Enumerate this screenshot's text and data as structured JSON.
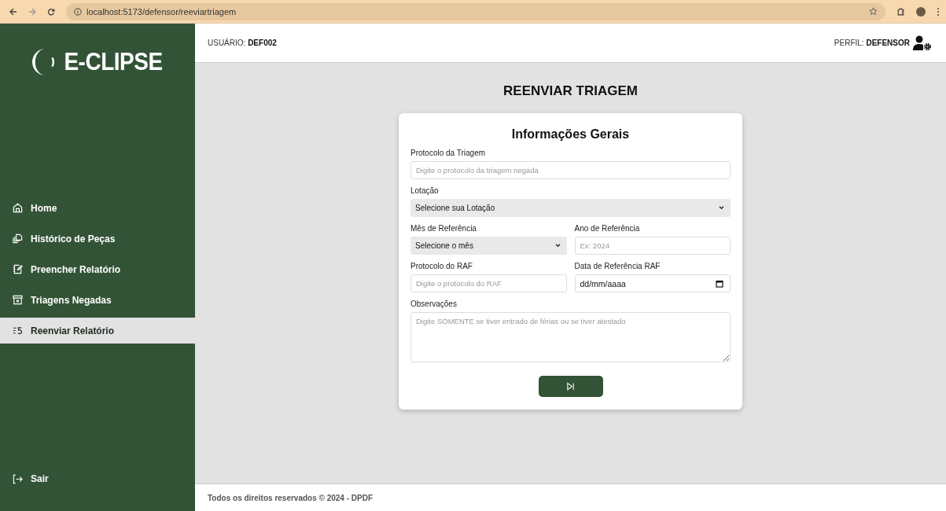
{
  "browser": {
    "url": "localhost:5173/defensor/reeviartriagem"
  },
  "header": {
    "user_label": "USUÁRIO:",
    "user_value": "DEF002",
    "profile_label": "PERFIL:",
    "profile_value": "DEFENSOR"
  },
  "sidebar": {
    "logo": "E-CLIPSE",
    "items": [
      {
        "label": "Home",
        "selected": false
      },
      {
        "label": "Histórico de Peças",
        "selected": false
      },
      {
        "label": "Preencher Relatório",
        "selected": false
      },
      {
        "label": "Triagens Negadas",
        "selected": false
      },
      {
        "label": "Reenviar Relatório",
        "selected": true
      }
    ],
    "logout": "Sair"
  },
  "page_title": "REENVIAR TRIAGEM",
  "form": {
    "title": "Informações Gerais",
    "rows": [
      [
        {
          "kind": "text",
          "label": "Protocolo da Triagem",
          "placeholder": "Digite o protocolo da triagem negada"
        }
      ],
      [
        {
          "kind": "select",
          "label": "Lotação",
          "value": "Selecione sua Lotação"
        }
      ],
      [
        {
          "kind": "select",
          "label": "Mês de Referência",
          "value": "Selecione o mês"
        },
        {
          "kind": "text",
          "label": "Ano de Referência",
          "placeholder": "Ex: 2024"
        }
      ],
      [
        {
          "kind": "text",
          "label": "Protocolo do RAF",
          "placeholder": "Digite o protocolo do RAF"
        },
        {
          "kind": "date",
          "label": "Data de Referência RAF",
          "value": "dd/mm/aaaa"
        }
      ],
      [
        {
          "kind": "textarea",
          "label": "Observações",
          "placeholder": "Digite SOMENTE se tiver entrado de férias ou se tiver atestado"
        }
      ]
    ]
  },
  "footer": "Todos os direitos reservados © 2024 - DPDF"
}
